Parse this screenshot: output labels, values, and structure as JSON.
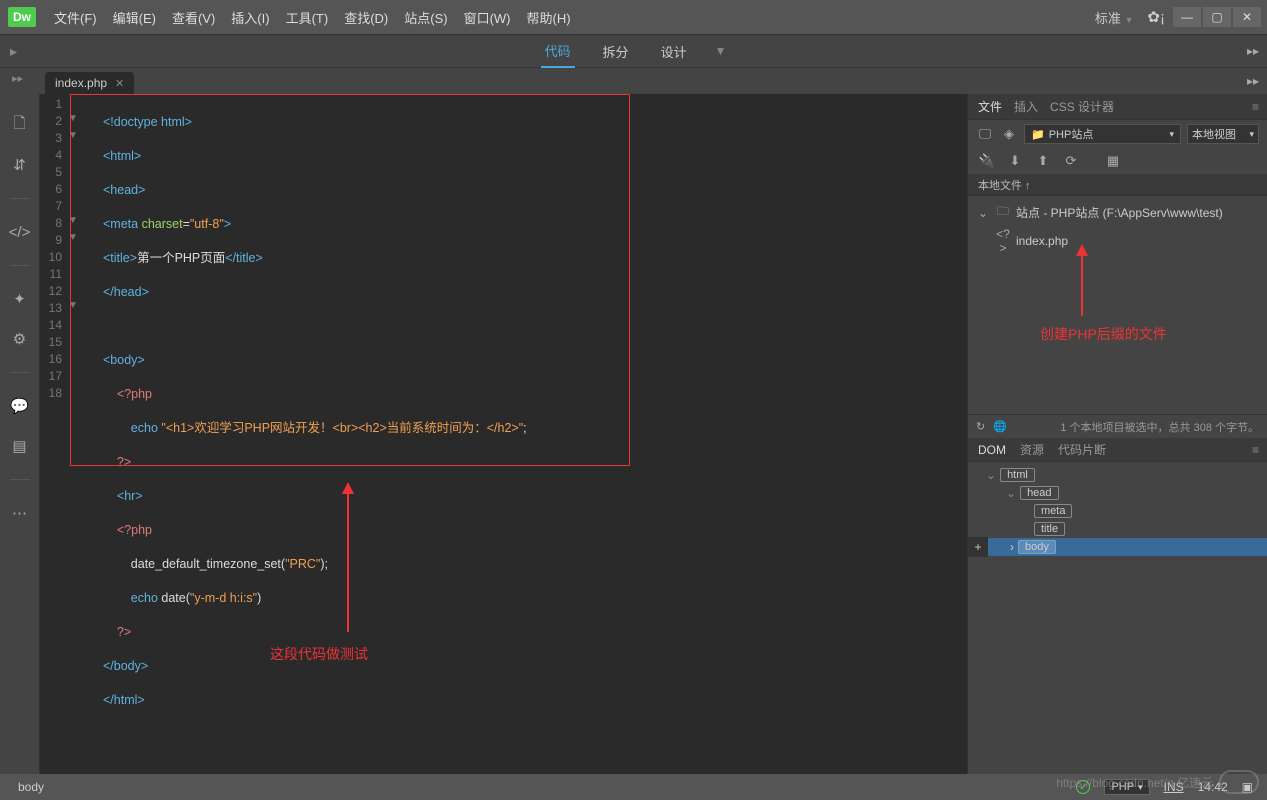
{
  "logo": "Dw",
  "menu": [
    "文件(F)",
    "编辑(E)",
    "查看(V)",
    "插入(I)",
    "工具(T)",
    "查找(D)",
    "站点(S)",
    "窗口(W)",
    "帮助(H)"
  ],
  "layout_dropdown": "标准",
  "views": {
    "code": "代码",
    "split": "拆分",
    "design": "设计"
  },
  "open_tab": "index.php",
  "code": {
    "lines": {
      "l1": {
        "n": "1",
        "raw": "<!doctype html>"
      },
      "l2": {
        "n": "2",
        "raw": "<html>"
      },
      "l3": {
        "n": "3",
        "raw": "<head>"
      },
      "l4": {
        "n": "4",
        "tagopen": "<meta ",
        "attr": "charset",
        "eq": "=",
        "val": "\"utf-8\"",
        "tagclose": ">"
      },
      "l5": {
        "n": "5",
        "open": "<title>",
        "text": "第一个PHP页面",
        "close": "</title>"
      },
      "l6": {
        "n": "6",
        "raw": "</head>"
      },
      "l7": {
        "n": "7",
        "raw": ""
      },
      "l8": {
        "n": "8",
        "raw": "<body>"
      },
      "l9": {
        "n": "9",
        "raw": "    <?php"
      },
      "l10": {
        "n": "10",
        "indent": "        ",
        "kw": "echo ",
        "str": "\"<h1>欢迎学习PHP网站开发！<br><h2>当前系统时间为：</h2>\"",
        "tail": ";"
      },
      "l11": {
        "n": "11",
        "raw": "    ?>"
      },
      "l12": {
        "n": "12",
        "raw": "    <hr>"
      },
      "l13": {
        "n": "13",
        "raw": "    <?php"
      },
      "l14": {
        "n": "14",
        "indent": "        ",
        "fn": "date_default_timezone_set(",
        "arg": "\"PRC\"",
        "tail": ");"
      },
      "l15": {
        "n": "15",
        "indent": "        ",
        "kw": "echo ",
        "fn": "date(",
        "arg": "\"y-m-d h:i:s\"",
        "tail": ")"
      },
      "l16": {
        "n": "16",
        "raw": "    ?>"
      },
      "l17": {
        "n": "17",
        "raw": "</body>"
      },
      "l18": {
        "n": "18",
        "raw": "</html>"
      }
    }
  },
  "annotation_code": "这段代码做测试",
  "annotation_file": "创建PHP后缀的文件",
  "right": {
    "tabs": {
      "files": "文件",
      "insert": "插入",
      "css": "CSS 设计器"
    },
    "site_select": "PHP站点",
    "view_select": "本地视图",
    "header": "本地文件 ↑",
    "site_root": "站点 - PHP站点 (F:\\AppServ\\www\\test)",
    "file_item": "index.php",
    "statusbar": "1 个本地项目被选中，总共 308 个字节。",
    "dom_tabs": {
      "dom": "DOM",
      "res": "资源",
      "snip": "代码片断"
    },
    "dom": {
      "html": "html",
      "head": "head",
      "meta": "meta",
      "title": "title",
      "body": "body"
    }
  },
  "status": {
    "crumb": "body",
    "lang": "PHP",
    "ins": "INS",
    "pos": "14:42"
  },
  "watermark": "https://blog.csdn.net/q    亿速云"
}
